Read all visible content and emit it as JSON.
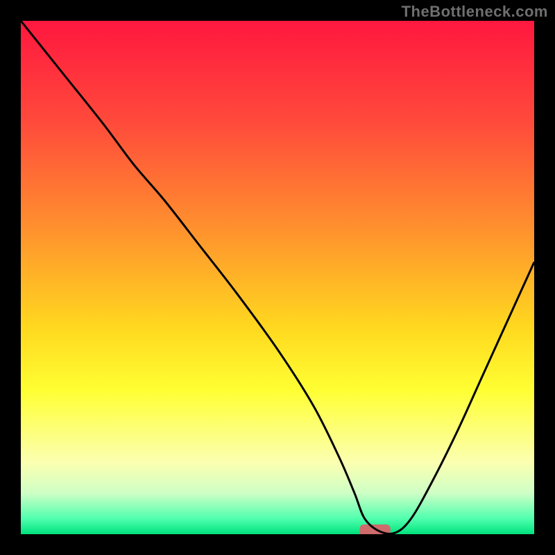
{
  "watermark": "TheBottleneck.com",
  "chart_data": {
    "type": "line",
    "title": "",
    "xlabel": "",
    "ylabel": "",
    "xlim": [
      0,
      100
    ],
    "ylim": [
      0,
      100
    ],
    "grid": false,
    "legend": false,
    "annotations": [],
    "background_gradient_stops": [
      {
        "offset": 0.0,
        "color": "#ff173f"
      },
      {
        "offset": 0.2,
        "color": "#ff4b3b"
      },
      {
        "offset": 0.4,
        "color": "#ff8f2e"
      },
      {
        "offset": 0.6,
        "color": "#ffd91f"
      },
      {
        "offset": 0.72,
        "color": "#ffff33"
      },
      {
        "offset": 0.86,
        "color": "#fbffb0"
      },
      {
        "offset": 0.92,
        "color": "#cfffc6"
      },
      {
        "offset": 0.97,
        "color": "#4fffae"
      },
      {
        "offset": 1.0,
        "color": "#00e27d"
      }
    ],
    "marker": {
      "x": 69,
      "y": 0.7,
      "w": 6,
      "h": 2.4,
      "color": "#cf6b6b"
    },
    "series": [
      {
        "name": "curve",
        "color": "#000000",
        "x": [
          0,
          8,
          16,
          22,
          28,
          35,
          42,
          50,
          57,
          62,
          65,
          67,
          70,
          73,
          76,
          80,
          85,
          90,
          95,
          100
        ],
        "y": [
          100,
          90,
          80,
          72,
          65,
          56,
          47,
          36,
          25,
          15,
          8,
          3,
          0.5,
          0.3,
          3,
          10,
          20,
          31,
          42,
          53
        ]
      }
    ]
  }
}
